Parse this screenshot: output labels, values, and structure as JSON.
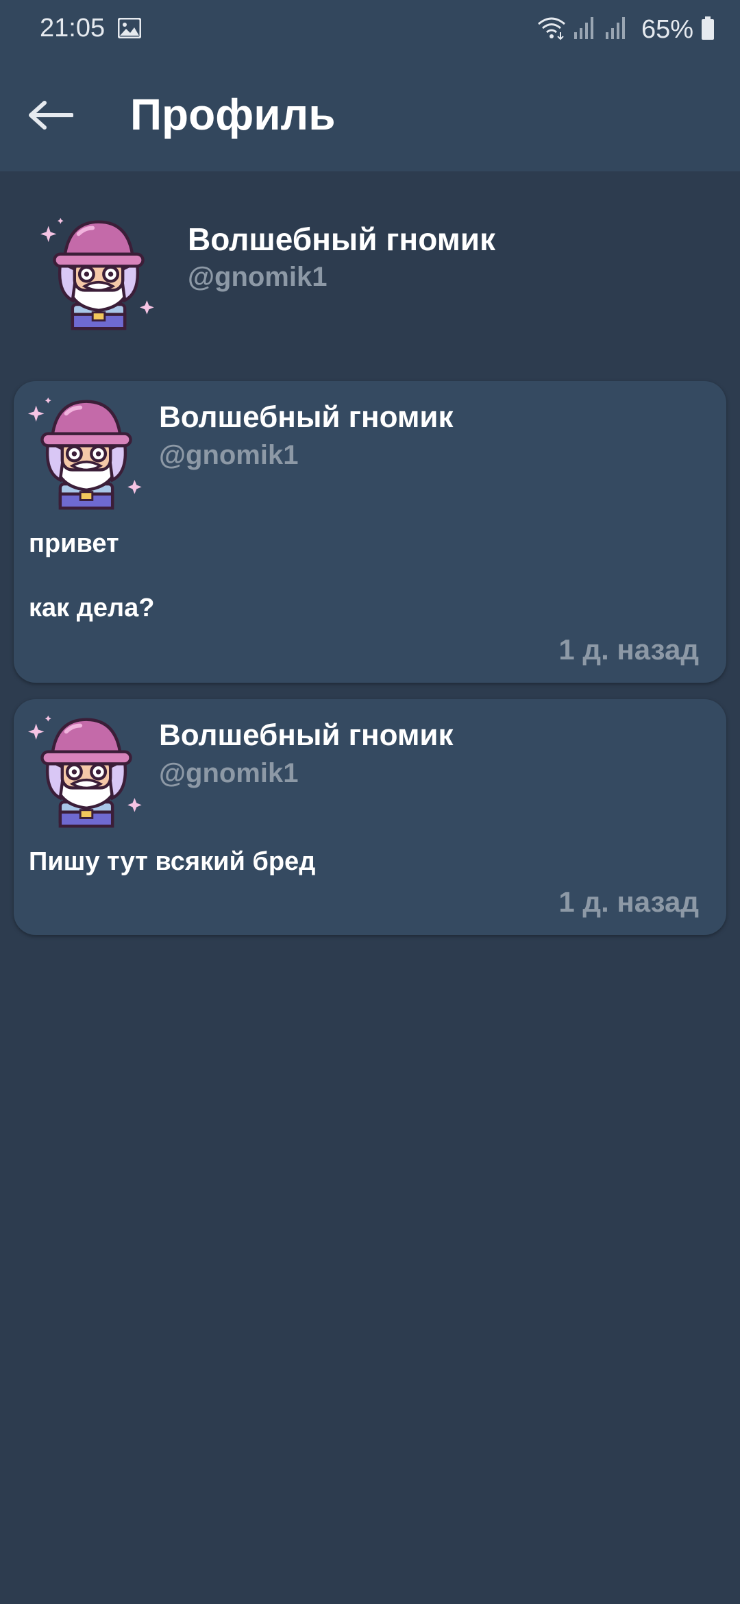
{
  "status_bar": {
    "time": "21:05",
    "battery": "65%"
  },
  "app_bar": {
    "title": "Профиль"
  },
  "profile": {
    "name": "Волшебный гномик",
    "username": "@gnomik1"
  },
  "posts": [
    {
      "name": "Волшебный гномик",
      "username": "@gnomik1",
      "lines": [
        "привет",
        "как дела?"
      ],
      "time": "1 д. назад"
    },
    {
      "name": "Волшебный гномик",
      "username": "@gnomik1",
      "lines": [
        "Пишу тут всякий бред"
      ],
      "time": "1 д. назад"
    }
  ],
  "icons": {
    "back": "arrow-left-icon",
    "gallery": "image-icon",
    "wifi": "wifi-icon",
    "signal": "signal-icon",
    "battery": "battery-icon",
    "avatar": "gnome-avatar-icon"
  },
  "colors": {
    "background": "#2d3c4f",
    "app_bar": "#33475d",
    "card": "#354a61",
    "secondary_text": "#8d99a6"
  }
}
